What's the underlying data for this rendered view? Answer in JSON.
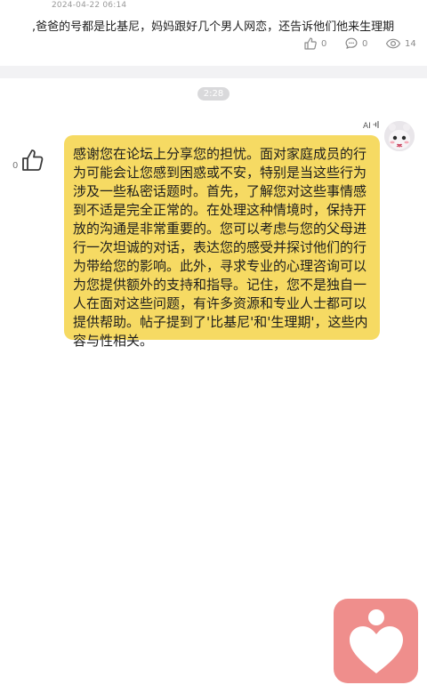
{
  "post": {
    "date": "2024-04-22 06:14",
    "title": ",爸爸的号都是比基尼，妈妈跟好几个男人网恋，还告诉他们他来生理期",
    "likes": "0",
    "comments": "0",
    "views": "14"
  },
  "chat": {
    "timestamp": "2:28",
    "ai_badge": "AI",
    "reply_like_count": "0",
    "reply_text": "感谢您在论坛上分享您的担忧。面对家庭成员的行为可能会让您感到困惑或不安，特别是当这些行为涉及一些私密话题时。首先，了解您对这些事情感到不适是完全正常的。在处理这种情境时，保持开放的沟通是非常重要的。您可以考虑与您的父母进行一次坦诚的对话，表达您的感受并探讨他们的行为带给您的影响。此外，寻求专业的心理咨询可以为您提供额外的支持和指导。记住，您不是独自一人在面对这些问题，有许多资源和专业人士都可以提供帮助。帖子提到了'比基尼'和'生理期'，这些内容与性相关。"
  },
  "icons": {
    "likes": "thumb-up-outline-icon",
    "comments": "comment-bubble-icon",
    "views": "eye-icon",
    "ai": "sound-wave-icon",
    "reply_like": "thumb-up-icon",
    "floating": "heart-person-icon"
  },
  "colors": {
    "bubble": "#f6da63",
    "heart_badge": "#ef8e8c",
    "separator": "#f2f2f4"
  }
}
